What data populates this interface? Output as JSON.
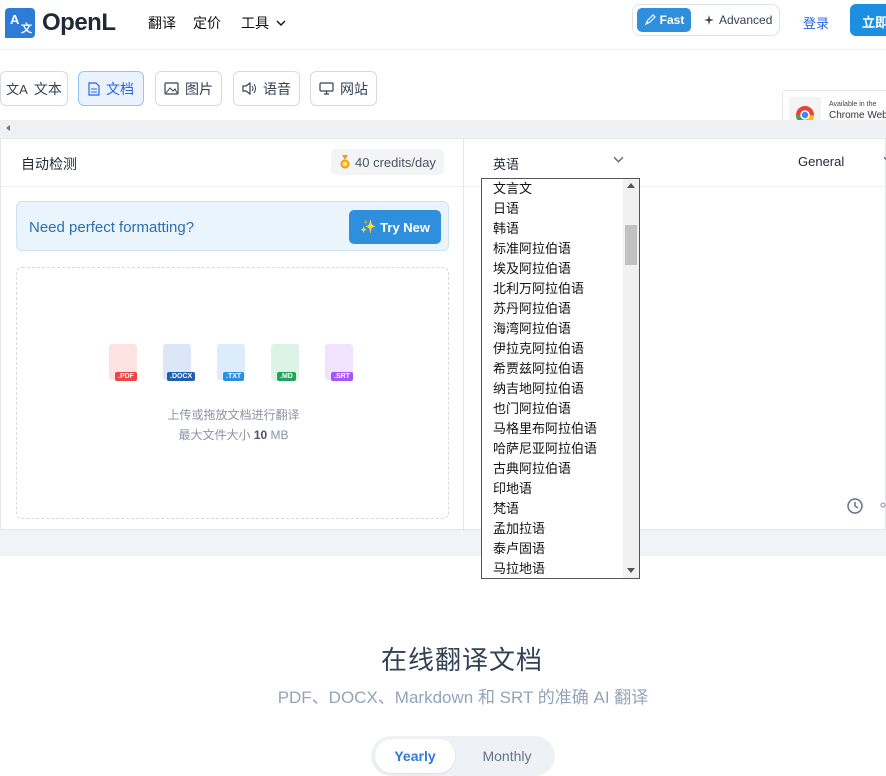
{
  "header": {
    "logo_text": "OpenL",
    "nav": [
      "翻译",
      "定价",
      "工具"
    ],
    "mode_fast": "Fast",
    "mode_advanced": "Advanced",
    "login": "登录",
    "cta": "立即"
  },
  "tabs": [
    {
      "label": "文本",
      "icon": "translate-icon"
    },
    {
      "label": "文档",
      "icon": "document-icon",
      "active": true
    },
    {
      "label": "图片",
      "icon": "image-icon"
    },
    {
      "label": "语音",
      "icon": "speaker-icon"
    },
    {
      "label": "网站",
      "icon": "monitor-icon"
    }
  ],
  "chrome_badge": {
    "line1": "Available in the",
    "line2": "Chrome Web"
  },
  "source": {
    "label": "自动检测",
    "credits": "40 credits/day"
  },
  "target": {
    "language": "英语",
    "mode": "General"
  },
  "promo": {
    "text": "Need perfect formatting?",
    "button": "Try New"
  },
  "dropzone": {
    "file_types": [
      ".PDF",
      ".DOCX",
      ".TXT",
      ".MD",
      ".SRT"
    ],
    "line1": "上传或拖放文档进行翻译",
    "line2_prefix": "最大文件大小",
    "line2_size": "10",
    "line2_unit": "MB"
  },
  "language_options": [
    "文言文",
    "日语",
    "韩语",
    "标准阿拉伯语",
    "埃及阿拉伯语",
    "北利万阿拉伯语",
    "苏丹阿拉伯语",
    "海湾阿拉伯语",
    "伊拉克阿拉伯语",
    "希贾兹阿拉伯语",
    "纳吉地阿拉伯语",
    "也门阿拉伯语",
    "马格里布阿拉伯语",
    "哈萨尼亚阿拉伯语",
    "古典阿拉伯语",
    "印地语",
    "梵语",
    "孟加拉语",
    "泰卢固语",
    "马拉地语"
  ],
  "hero": {
    "title": "在线翻译文档",
    "subtitle": "PDF、DOCX、Markdown 和 SRT 的准确 AI 翻译"
  },
  "billing": {
    "yearly": "Yearly",
    "monthly": "Monthly"
  },
  "colors": {
    "accent": "#2f8fdd",
    "pdf": "#ef4444",
    "docx": "#1e5fae",
    "txt": "#2f8fdd",
    "md": "#22a35a",
    "srt": "#a855f7"
  }
}
